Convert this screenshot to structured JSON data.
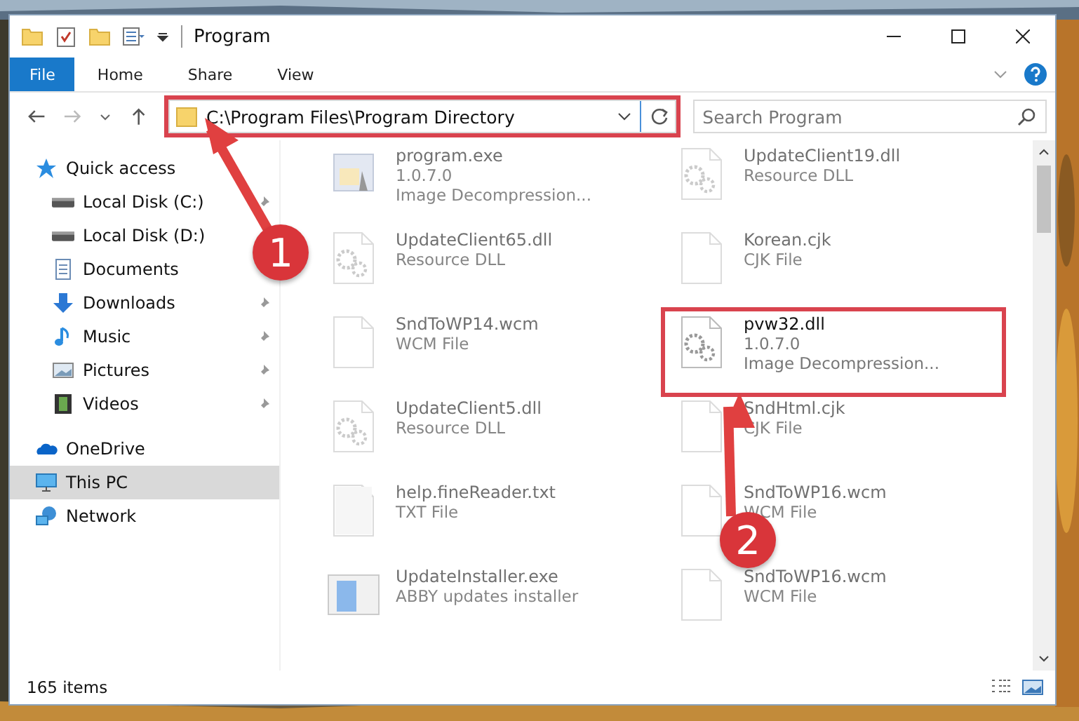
{
  "window": {
    "title": "Program"
  },
  "ribbon_tabs": [
    {
      "label": "File",
      "selected": true
    },
    {
      "label": "Home",
      "selected": false
    },
    {
      "label": "Share",
      "selected": false
    },
    {
      "label": "View",
      "selected": false
    }
  ],
  "address_bar": {
    "value": "C:\\Program Files\\Program Directory",
    "highlighted": true
  },
  "search": {
    "placeholder": "Search Program"
  },
  "sidebar": {
    "items": [
      {
        "label": "Quick access",
        "kind": "star",
        "pinned": false,
        "selected": false,
        "children": [
          {
            "label": "Local Disk (C:)",
            "kind": "disk",
            "pinned": true,
            "selected": false
          },
          {
            "label": "Local Disk (D:)",
            "kind": "disk",
            "selected": false
          },
          {
            "label": "Documents",
            "kind": "doc",
            "selected": false
          },
          {
            "label": "Downloads",
            "kind": "download",
            "pinned": true,
            "selected": false
          },
          {
            "label": "Music",
            "kind": "music",
            "pinned": true,
            "selected": false
          },
          {
            "label": "Pictures",
            "kind": "pictures",
            "pinned": true,
            "selected": false
          },
          {
            "label": "Videos",
            "kind": "video",
            "pinned": true,
            "selected": false
          }
        ]
      },
      {
        "label": "OneDrive",
        "kind": "cloud",
        "pinned": false,
        "selected": false
      },
      {
        "label": "This PC",
        "kind": "pc",
        "pinned": false,
        "selected": true
      },
      {
        "label": "Network",
        "kind": "network",
        "pinned": false,
        "selected": false
      }
    ]
  },
  "files": [
    {
      "name": "program.exe",
      "lines": [
        "1.0.7.0",
        "Image Decompression..."
      ],
      "kind": "exe",
      "dimmed": true,
      "highlighted": false
    },
    {
      "name": "UpdateClient19.dll",
      "lines": [
        "Resource DLL"
      ],
      "kind": "dll",
      "dimmed": true,
      "highlighted": false
    },
    {
      "name": "UpdateClient65.dll",
      "lines": [
        "Resource DLL"
      ],
      "kind": "dll",
      "dimmed": true,
      "highlighted": false
    },
    {
      "name": "Korean.cjk",
      "lines": [
        "CJK File"
      ],
      "kind": "file",
      "dimmed": true,
      "highlighted": false
    },
    {
      "name": "SndToWP14.wcm",
      "lines": [
        "WCM File"
      ],
      "kind": "file",
      "dimmed": true,
      "highlighted": false
    },
    {
      "name": "pvw32.dll",
      "lines": [
        "1.0.7.0",
        "Image Decompression..."
      ],
      "kind": "dll",
      "dimmed": false,
      "highlighted": true
    },
    {
      "name": "UpdateClient5.dll",
      "lines": [
        "Resource DLL"
      ],
      "kind": "dll",
      "dimmed": true,
      "highlighted": false
    },
    {
      "name": "SndHtml.cjk",
      "lines": [
        "CJK File"
      ],
      "kind": "file",
      "dimmed": true,
      "highlighted": false
    },
    {
      "name": "help.fineReader.txt",
      "lines": [
        "TXT File"
      ],
      "kind": "txt",
      "dimmed": true,
      "highlighted": false
    },
    {
      "name": "SndToWP16.wcm",
      "lines": [
        "WCM File"
      ],
      "kind": "file",
      "dimmed": true,
      "highlighted": false
    },
    {
      "name": "UpdateInstaller.exe",
      "lines": [
        "ABBY updates installer"
      ],
      "kind": "installer",
      "dimmed": true,
      "highlighted": false
    },
    {
      "name": "SndToWP16.wcm",
      "lines": [
        "WCM File"
      ],
      "kind": "file",
      "dimmed": true,
      "highlighted": false
    }
  ],
  "status_bar": {
    "count": "165 items"
  },
  "annotations": [
    {
      "number": "1"
    },
    {
      "number": "2"
    }
  ]
}
